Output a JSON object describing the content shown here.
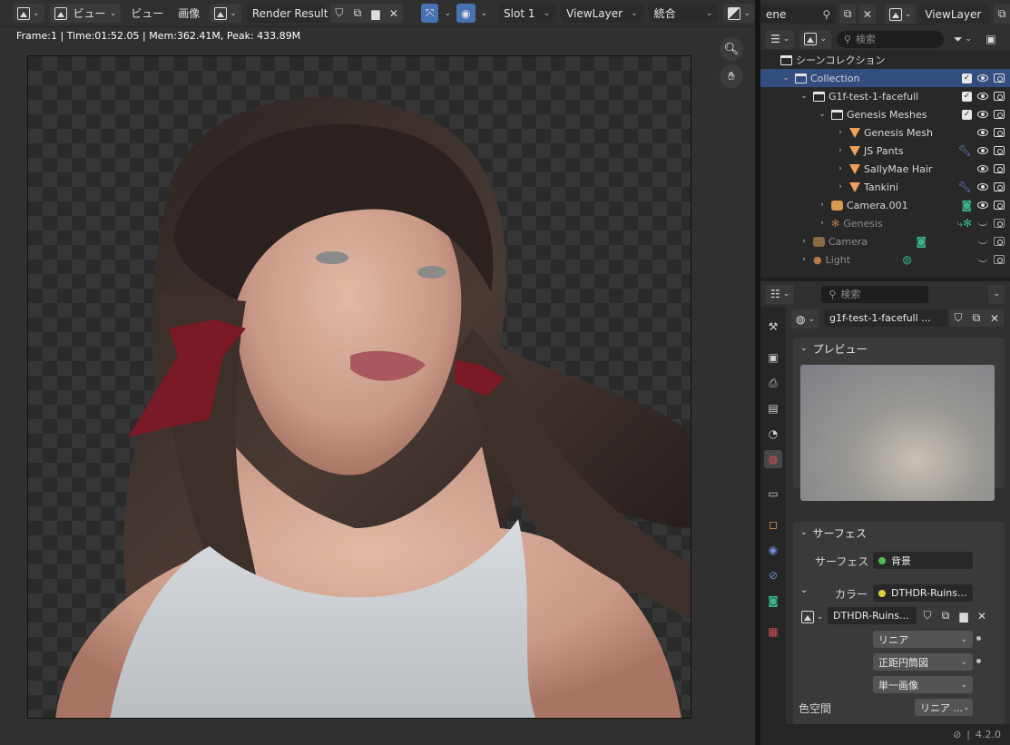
{
  "image_editor": {
    "header": {
      "view_menu_1": "ビュー",
      "view_menu_2": "ビュー",
      "image_menu": "画像",
      "image_name": "Render Result",
      "slot": "Slot 1",
      "view_layer": "ViewLayer",
      "pass": "統合"
    },
    "info": "Frame:1 | Time:01:52.05 | Mem:362.41M, Peak: 433.89M"
  },
  "topbar": {
    "scene_name": "ene",
    "view_layer": "ViewLayer"
  },
  "outliner": {
    "search_placeholder": "検索",
    "root": "シーンコレクション",
    "rows": [
      {
        "name": "Collection"
      },
      {
        "name": "G1f-test-1-facefull"
      },
      {
        "name": "Genesis Meshes"
      },
      {
        "name": "Genesis Mesh"
      },
      {
        "name": "JS Pants"
      },
      {
        "name": "SallyMae Hair"
      },
      {
        "name": "Tankini"
      },
      {
        "name": "Camera.001"
      },
      {
        "name": "Genesis"
      },
      {
        "name": "Camera"
      },
      {
        "name": "Light"
      }
    ]
  },
  "properties": {
    "search_placeholder": "検索",
    "world_name": "g1f-test-1-facefull ...",
    "preview_panel": "プレビュー",
    "surface_panel": "サーフェス",
    "surface_label": "サーフェス",
    "surface_value": "背景",
    "color_label": "カラー",
    "color_value": "DTHDR-Ruins...",
    "image_name": "DTHDR-Ruins...",
    "interpolation": "リニア",
    "projection": "正距円筒図",
    "source": "単一画像",
    "colorspace_label": "色空間",
    "colorspace_value": "リニア ..."
  },
  "status": {
    "version": "4.2.0"
  }
}
